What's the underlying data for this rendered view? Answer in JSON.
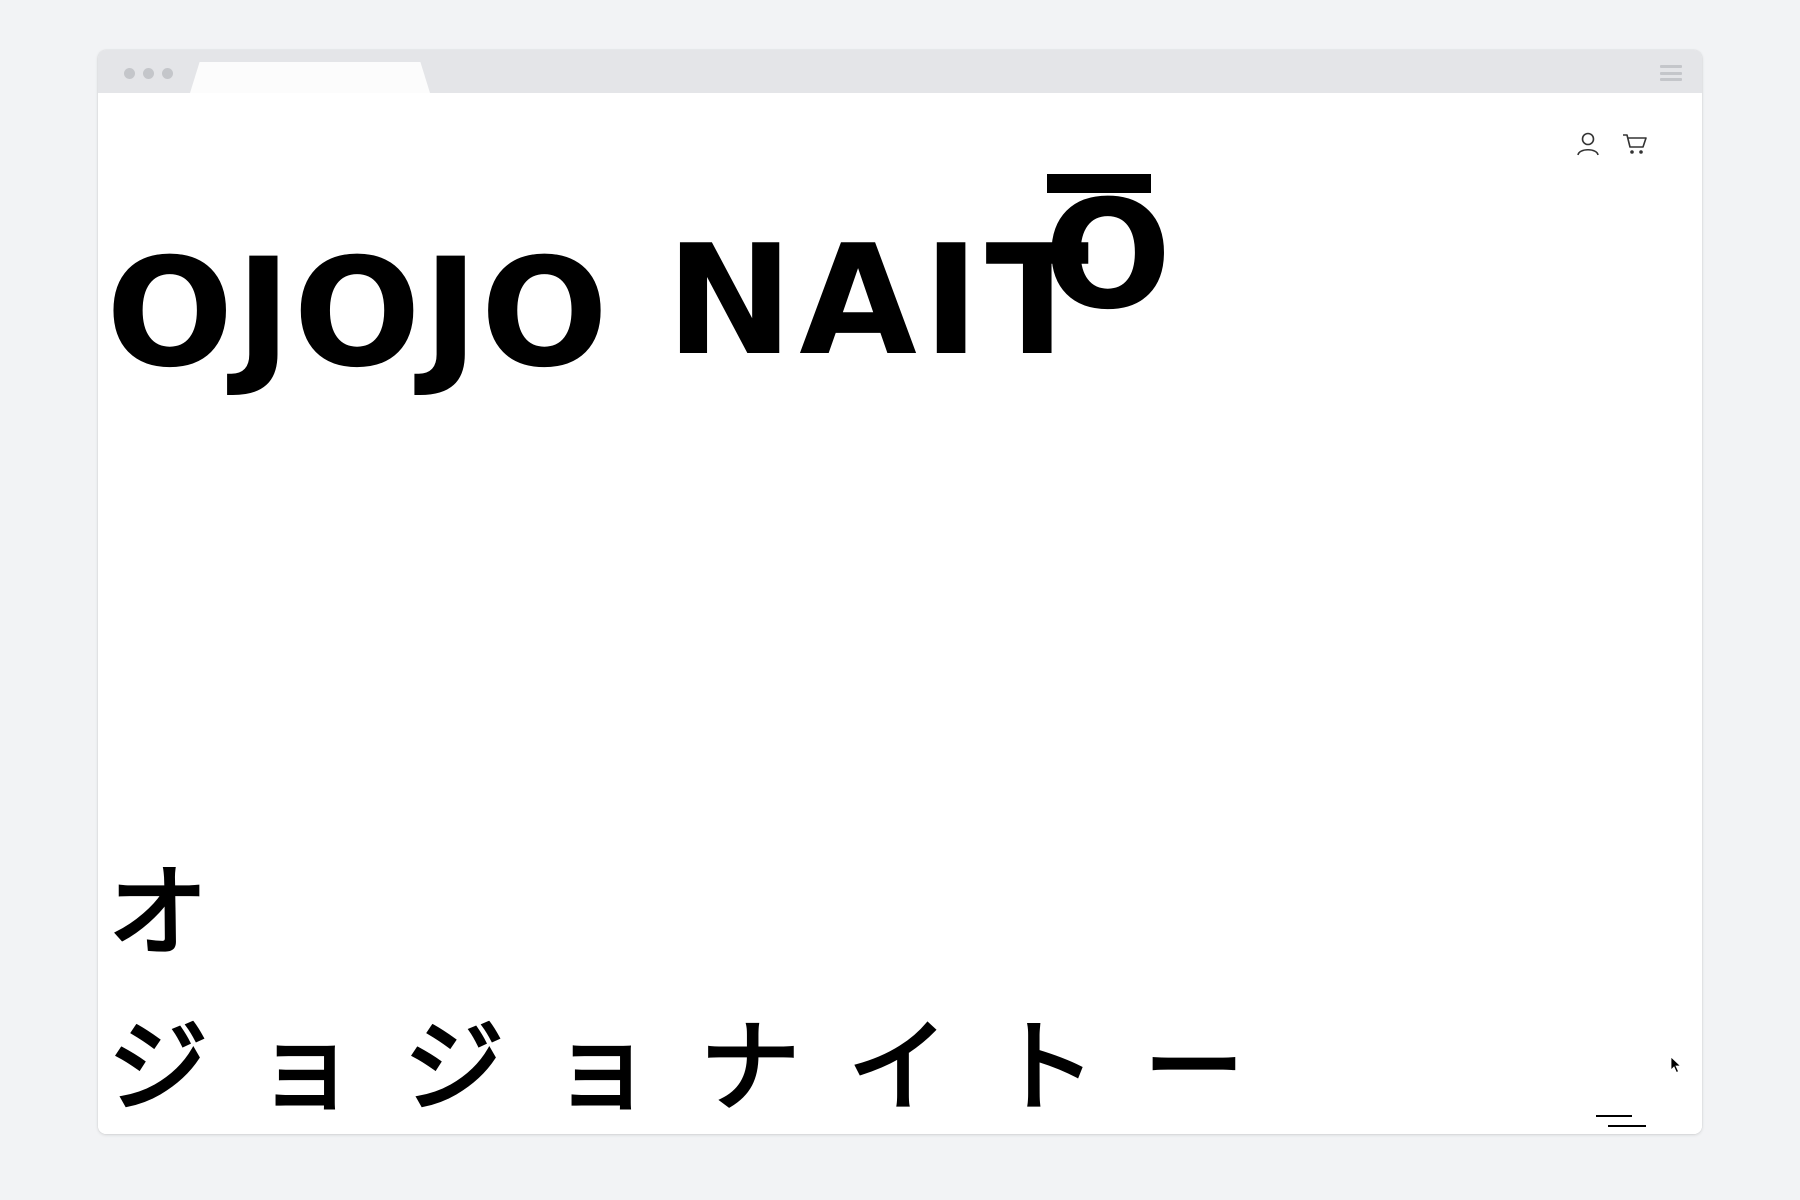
{
  "brand": {
    "word1": "OJOJO",
    "word2": "NAIT",
    "word3": "O",
    "katakana_line1": "オ",
    "katakana_line2": "ジョジョナイトー"
  },
  "header": {
    "icons": [
      "user-icon",
      "cart-icon"
    ]
  },
  "browser": {
    "menu_icon": "hamburger-icon"
  },
  "colors": {
    "background": "#f2f3f5",
    "chrome": "#e4e5e8",
    "text": "#000000",
    "page": "#ffffff"
  }
}
